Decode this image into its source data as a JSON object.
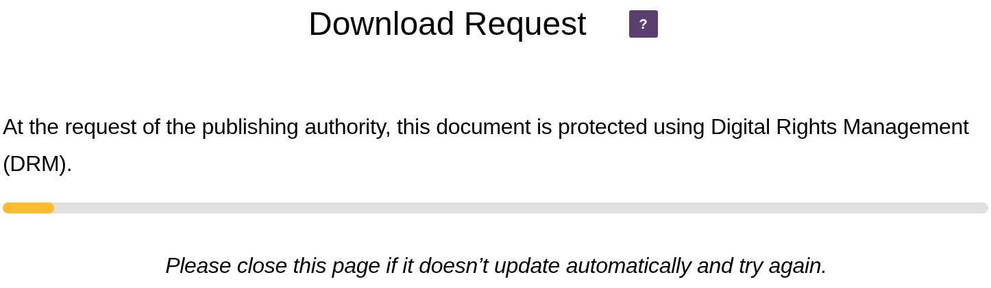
{
  "title": "Download Request",
  "help_button": {
    "label": "?"
  },
  "message": "At the request of the publishing authority, this document is protected using Digital Rights Management (DRM).",
  "progress": {
    "level": 0.052
  },
  "note": "Please close this page if it doesn’t update automatically and try again."
}
